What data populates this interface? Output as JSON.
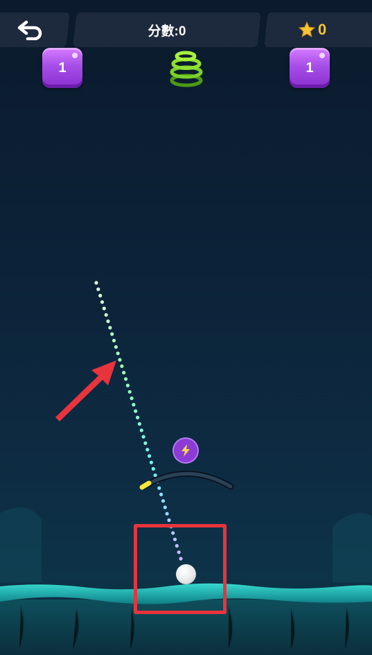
{
  "header": {
    "score_label": "分數:0",
    "stars_count": "0"
  },
  "blocks": [
    {
      "label": "1",
      "color": "#a64ee8"
    },
    {
      "label": "1",
      "color": "#a64ee8"
    }
  ],
  "icons": {
    "back": "back-arrow-icon",
    "star": "star-icon",
    "spring": "spring-icon",
    "power": "lightning-bolt-icon"
  },
  "colors": {
    "background": "#0c2238",
    "ground": "#1fb8b0",
    "highlight_box": "#e8343c",
    "hint_arrow": "#e8343c",
    "paddle_tip": "#f4e93a"
  }
}
